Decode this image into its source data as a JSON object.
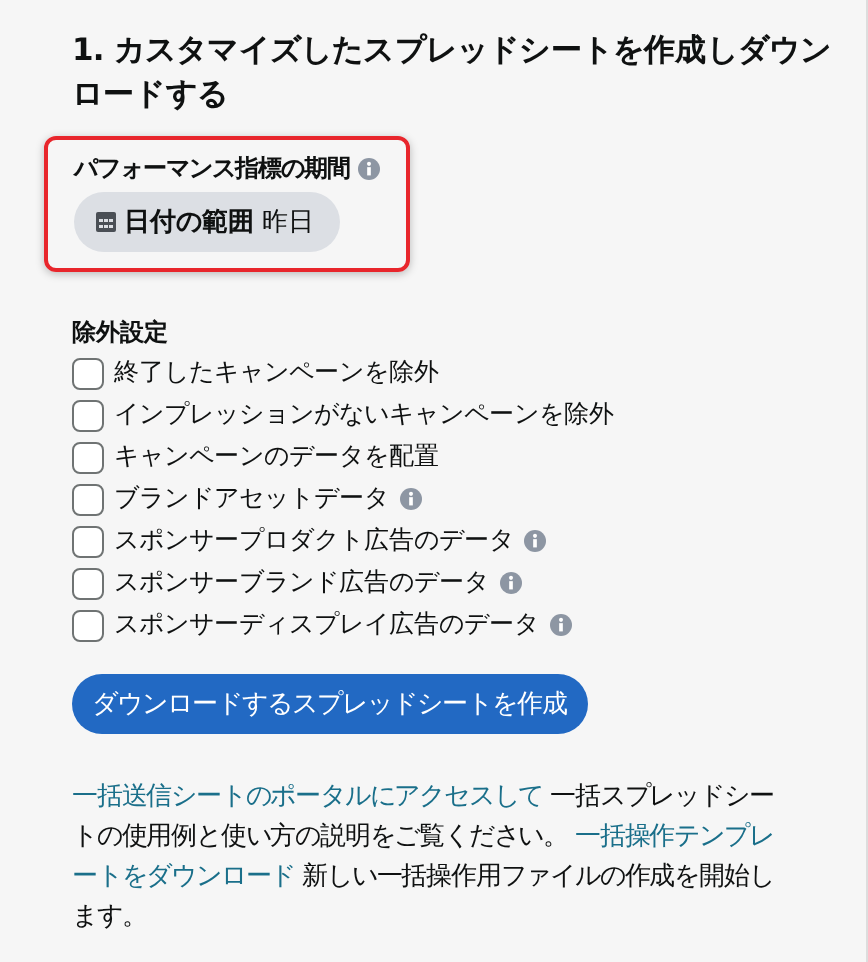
{
  "heading": "1. カスタマイズしたスプレッドシートを作成しダウンロードする",
  "period": {
    "label": "パフォーマンス指標の期間",
    "highlighted": true,
    "date_button": {
      "label": "日付の範囲",
      "value": "昨日"
    }
  },
  "exclusions": {
    "title": "除外設定",
    "options": [
      {
        "label": "終了したキャンペーンを除外",
        "checked": false,
        "info": false
      },
      {
        "label": "インプレッションがないキャンペーンを除外",
        "checked": false,
        "info": false
      },
      {
        "label": "キャンペーンのデータを配置",
        "checked": false,
        "info": false
      },
      {
        "label": "ブランドアセットデータ",
        "checked": false,
        "info": true
      },
      {
        "label": "スポンサープロダクト広告のデータ",
        "checked": false,
        "info": true
      },
      {
        "label": "スポンサーブランド広告のデータ",
        "checked": false,
        "info": true
      },
      {
        "label": "スポンサーディスプレイ広告のデータ",
        "checked": false,
        "info": true
      }
    ]
  },
  "create_button": "ダウンロードするスプレッドシートを作成",
  "help_lines": [
    [
      {
        "kind": "link",
        "text": "一括送信シートのポータルにアクセスして"
      },
      {
        "kind": "text",
        "text": " 一括スプレッドシー"
      }
    ],
    [
      {
        "kind": "text",
        "text": "トの使用例と使い方の説明をご覧ください。 "
      },
      {
        "kind": "link",
        "text": "一括操作テンプレ"
      }
    ],
    [
      {
        "kind": "link",
        "text": "ートをダウンロード"
      },
      {
        "kind": "text",
        "text": " 新しい一括操作用ファイルの作成を開始し"
      }
    ],
    [
      {
        "kind": "text",
        "text": "ます。"
      }
    ]
  ]
}
